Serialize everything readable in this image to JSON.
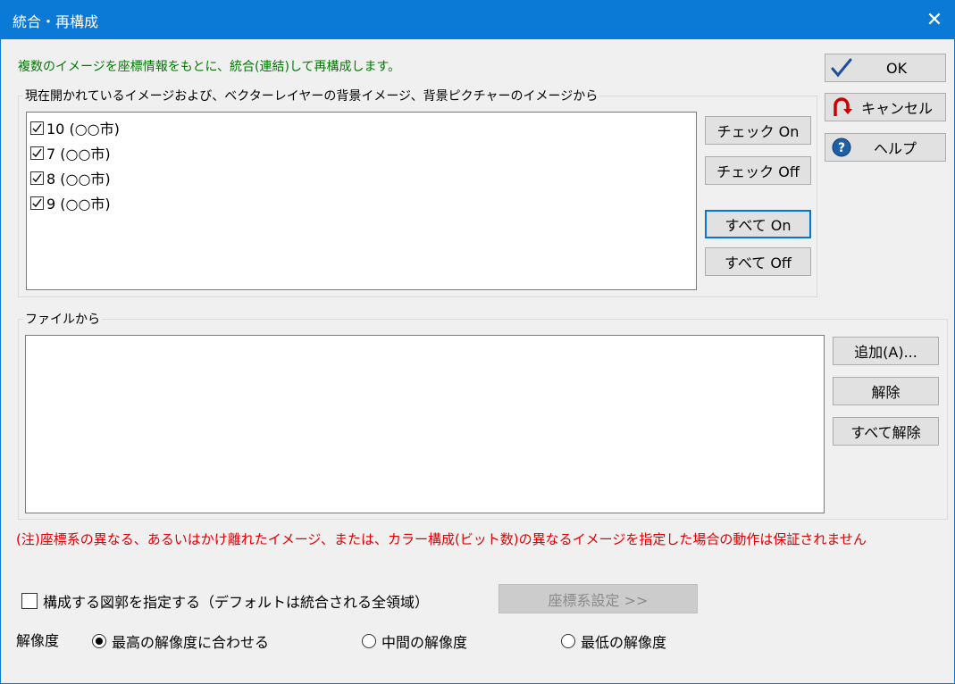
{
  "window": {
    "title": "統合・再構成",
    "close_glyph": "✕"
  },
  "intro_text": "複数のイメージを座標情報をもとに、統合(連結)して再構成します。",
  "open_images_group": {
    "label": "現在開かれているイメージおよび、ベクターレイヤーの背景イメージ、背景ピクチャーのイメージから",
    "items": [
      {
        "label": "10 (○○市)",
        "checked": true
      },
      {
        "label": "7 (○○市)",
        "checked": true
      },
      {
        "label": "8 (○○市)",
        "checked": true
      },
      {
        "label": "9 (○○市)",
        "checked": true
      }
    ],
    "buttons": {
      "check_on": "チェック On",
      "check_off": "チェック Off",
      "all_on": "すべて On",
      "all_off": "すべて Off"
    }
  },
  "file_group": {
    "label": "ファイルから",
    "buttons": {
      "add": "追加(A)...",
      "remove": "解除",
      "remove_all": "すべて解除"
    }
  },
  "dialog_buttons": {
    "ok": "OK",
    "cancel": "キャンセル",
    "help": "ヘルプ"
  },
  "note": "(注)座標系の異なる、あるいはかけ離れたイメージ、または、カラー構成(ビット数)の異なるイメージを指定した場合の動作は保証されません",
  "region_checkbox": {
    "label": "構成する図郭を指定する（デフォルトは統合される全領域）",
    "checked": false
  },
  "coord_button": "座標系設定 >>",
  "resolution": {
    "label": "解像度",
    "options": [
      {
        "label": "最高の解像度に合わせる",
        "selected": true
      },
      {
        "label": "中間の解像度",
        "selected": false
      },
      {
        "label": "最低の解像度",
        "selected": false
      }
    ]
  },
  "colors": {
    "titlebar": "#0b79d6",
    "intro": "#007a00",
    "note": "#e00000",
    "ok_check": "#1f4e9c",
    "cancel_arrow": "#cc0000",
    "help_circle": "#1f5fa8"
  }
}
